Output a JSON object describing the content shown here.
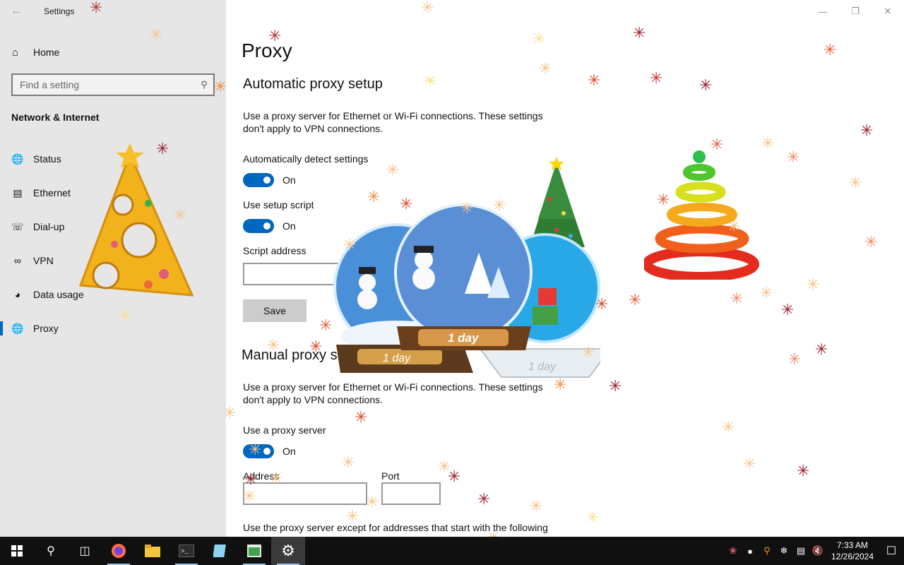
{
  "window": {
    "title": "Settings",
    "back_icon": "back-arrow-icon",
    "controls": [
      "minimize",
      "restore",
      "close"
    ]
  },
  "nav": {
    "home_label": "Home",
    "search_placeholder": "Find a setting",
    "section_heading": "Network & Internet",
    "items": [
      {
        "label": "Status",
        "icon": "globe-status-icon",
        "selected": false
      },
      {
        "label": "Ethernet",
        "icon": "ethernet-icon",
        "selected": false
      },
      {
        "label": "Dial-up",
        "icon": "dialup-icon",
        "selected": false
      },
      {
        "label": "VPN",
        "icon": "vpn-icon",
        "selected": false
      },
      {
        "label": "Data usage",
        "icon": "data-usage-icon",
        "selected": false
      },
      {
        "label": "Proxy",
        "icon": "proxy-globe-icon",
        "selected": true
      }
    ]
  },
  "page": {
    "title": "Proxy",
    "auto": {
      "heading": "Automatic proxy setup",
      "description": "Use a proxy server for Ethernet or Wi-Fi connections. These settings don't apply to VPN connections.",
      "detect_label": "Automatically detect settings",
      "detect_state": "On",
      "script_label": "Use setup script",
      "script_state": "On",
      "address_label": "Script address",
      "address_value": "",
      "save_label": "Save"
    },
    "manual": {
      "heading": "Manual proxy setup",
      "description": "Use a proxy server for Ethernet or Wi-Fi connections. These settings don't apply to VPN connections.",
      "use_label": "Use a proxy server",
      "use_state": "On",
      "address_label": "Address",
      "address_value": "",
      "port_label": "Port",
      "port_value": "",
      "exceptions_text": "Use the proxy server except for addresses that start with the following"
    }
  },
  "decorations": {
    "snow_globe_labels": [
      "1 day",
      "1 day",
      "1 day"
    ]
  },
  "taskbar": {
    "apps": [
      "start-icon",
      "search-icon",
      "task-view-icon",
      "firefox-icon",
      "file-explorer-icon",
      "terminal-icon",
      "notepad-icon",
      "settings-app-icon",
      "settings-gear-icon"
    ],
    "clock_time": "7:33 AM",
    "clock_date": "12/26/2024"
  },
  "colors": {
    "accent": "#0067c0",
    "nav_background": "#e6e6e6",
    "taskbar": "#101010"
  }
}
